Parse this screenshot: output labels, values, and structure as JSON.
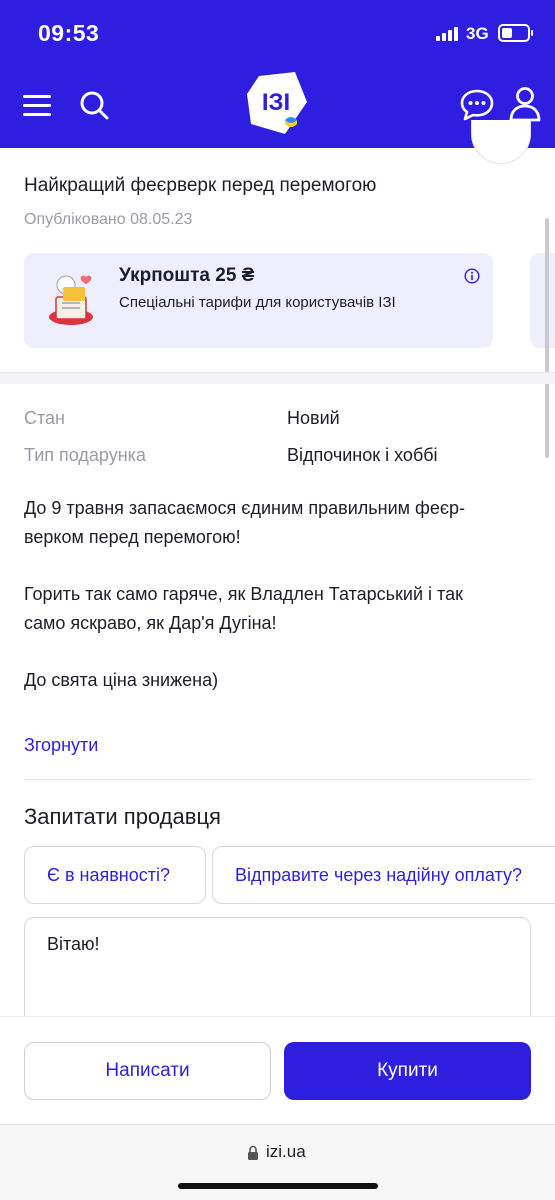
{
  "status_bar": {
    "time": "09:53",
    "network": "3G"
  },
  "header": {
    "logo_text": "ІЗІ",
    "icons": [
      "menu-icon",
      "search-icon",
      "chat-icon",
      "user-icon"
    ],
    "accent_color": "#2e1ee0"
  },
  "listing": {
    "title": "Найкращий феєрверк перед перемогою",
    "published": "Опубліковано 08.05.23"
  },
  "promo": {
    "title": "Укрпошта 25 ₴",
    "subtitle": "Спеціальні тарифи для користувачів ІЗІ"
  },
  "attributes": [
    {
      "label": "Стан",
      "value": "Новий"
    },
    {
      "label": "Тип подарунка",
      "value": "Відпочинок і хоббі"
    }
  ],
  "description": {
    "p1_line1": "До 9 травня запасаємося єдиним правильним феєр-",
    "p1_line2": "верком перед перемогою!",
    "p2_line1": "Горить так само гаряче, як Владлен Татарський і так",
    "p2_line2": "само яскраво, як Дар'я Дугіна!",
    "p3": "До свята ціна знижена)"
  },
  "collapse_label": "Згорнути",
  "ask_seller": {
    "title": "Запитати продавця",
    "chips": [
      "Є в наявності?",
      "Відправите через надійну оплату?"
    ],
    "message": "Вітаю!"
  },
  "actions": {
    "write_label": "Написати",
    "buy_label": "Купити"
  },
  "browser": {
    "url": "izi.ua"
  }
}
